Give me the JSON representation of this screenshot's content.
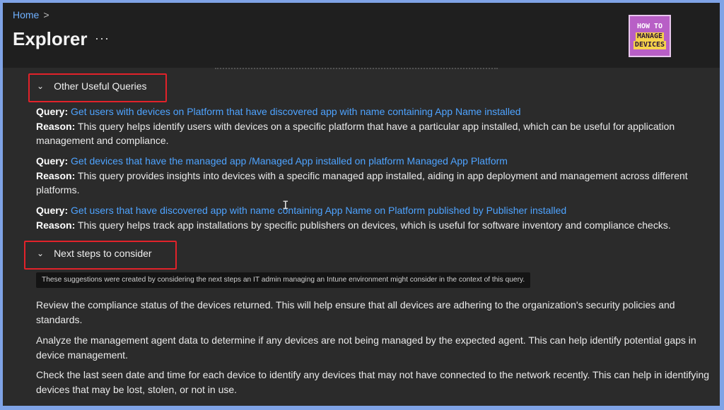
{
  "breadcrumb": {
    "home": "Home",
    "separator": ">"
  },
  "page": {
    "title": "Explorer",
    "more": "···"
  },
  "logo": {
    "line1": "HOW TO",
    "line2": "MANAGE",
    "line3": "DEVICES"
  },
  "sections": {
    "useful_queries": {
      "title": "Other Useful Queries",
      "chevron": "chevron-down-icon"
    },
    "next_steps": {
      "title": "Next steps to consider",
      "chevron": "chevron-down-icon"
    }
  },
  "labels": {
    "query": "Query:",
    "reason": "Reason:"
  },
  "queries": [
    {
      "link": "Get users with devices on Platform that have discovered app with name containing App Name installed",
      "reason": "This query helps identify users with devices on a specific platform that have a particular app installed, which can be useful for application management and compliance."
    },
    {
      "link": "Get devices that have the managed app /Managed App installed on platform Managed App Platform",
      "reason": "This query provides insights into devices with a specific managed app installed, aiding in app deployment and management across different platforms."
    },
    {
      "link": "Get users that have discovered app with name containing App Name on Platform published by Publisher installed",
      "reason": "This query helps track app installations by specific publishers on devices, which is useful for software inventory and compliance checks."
    }
  ],
  "tooltip": "These suggestions were created by considering the next steps an IT admin managing an Intune environment might consider in the context of this query.",
  "steps": [
    "Review the compliance status of the devices returned. This will help ensure that all devices are adhering to the organization's security policies and standards.",
    "Analyze the management agent data to determine if any devices are not being managed by the expected agent. This can help identify potential gaps in device management.",
    "Check the last seen date and time for each device to identify any devices that may not have connected to the network recently. This can help in identifying devices that may be lost, stolen, or not in use."
  ],
  "colors": {
    "link": "#4ea3ff",
    "highlight": "#e2222a",
    "background": "#2b2b2b"
  }
}
